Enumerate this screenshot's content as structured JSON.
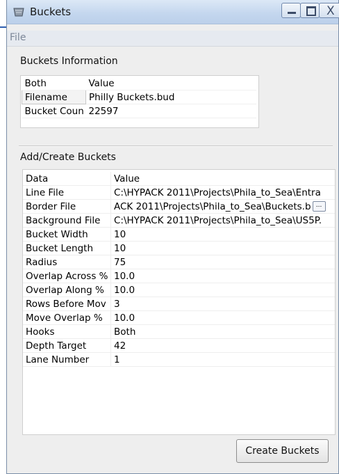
{
  "window": {
    "title": "Buckets",
    "minimize_icon": "minimize-icon",
    "maximize_icon": "maximize-icon",
    "close_icon": "close-icon",
    "close_glyph": "X"
  },
  "menu": {
    "file_label": "File"
  },
  "info_group": {
    "title": "Buckets Information",
    "header": [
      "Both",
      "Value"
    ],
    "rows": [
      [
        "Filename",
        "Philly Buckets.bud"
      ],
      [
        "Bucket Coun",
        "22597"
      ]
    ]
  },
  "create_group": {
    "title": "Add/Create Buckets",
    "header": [
      "Data",
      "Value"
    ],
    "rows": [
      [
        "Line File",
        "C:\\HYPACK 2011\\Projects\\Phila_to_Sea\\Entra"
      ],
      [
        "Border File",
        "ACK 2011\\Projects\\Phila_to_Sea\\Buckets.b"
      ],
      [
        "Background File",
        "C:\\HYPACK 2011\\Projects\\Phila_to_Sea\\US5P."
      ],
      [
        "Bucket Width",
        "10"
      ],
      [
        "Bucket Length",
        "10"
      ],
      [
        "Radius",
        "75"
      ],
      [
        "Overlap Across %",
        "10.0"
      ],
      [
        "Overlap Along %",
        "10.0"
      ],
      [
        "Rows Before Mov",
        "3"
      ],
      [
        "Move Overlap %",
        "10.0"
      ],
      [
        "Hooks",
        "Both"
      ],
      [
        "Depth Target",
        "42"
      ],
      [
        "Lane Number",
        "1"
      ]
    ],
    "ellipsis_label": "..."
  },
  "create_button_label": "Create Buckets"
}
